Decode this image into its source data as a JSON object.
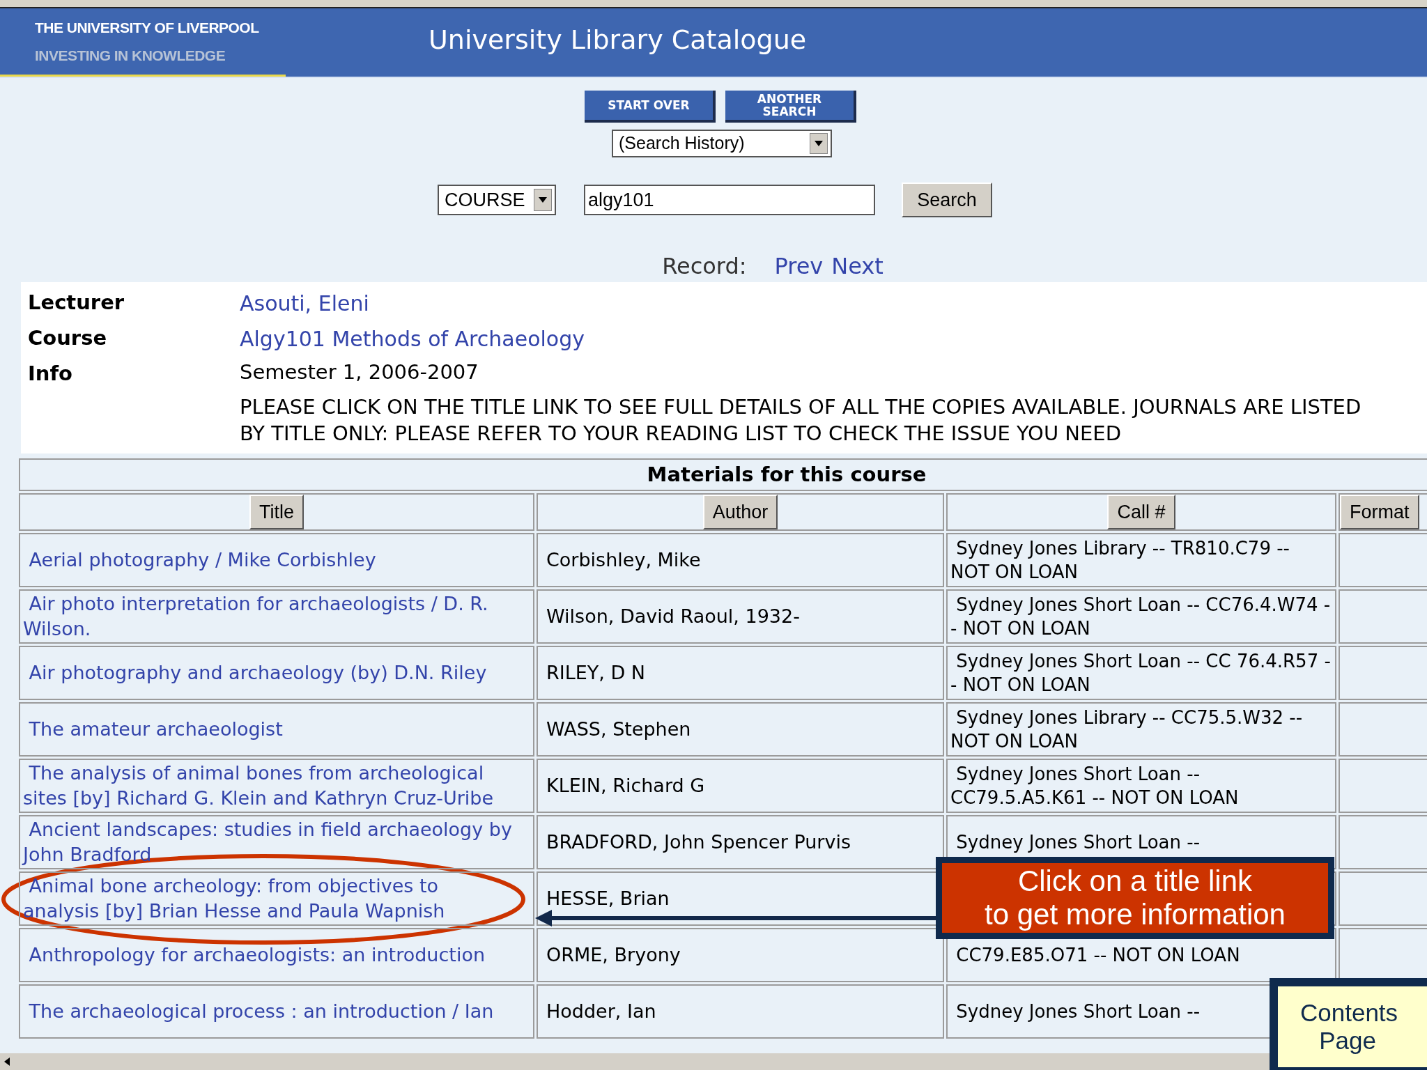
{
  "header": {
    "institution": "THE UNIVERSITY OF LIVERPOOL",
    "tagline": "INVESTING IN KNOWLEDGE",
    "title": "University Library Catalogue"
  },
  "nav_buttons": [
    "START OVER",
    "ANOTHER SEARCH"
  ],
  "history_select": {
    "value": "(Search History)"
  },
  "search": {
    "field": "COURSE",
    "query": "algy101",
    "button": "Search"
  },
  "record_nav": {
    "label": "Record:",
    "links": [
      "Prev",
      "Next"
    ]
  },
  "info": [
    {
      "label": "Lecturer",
      "value": "Asouti, Eleni",
      "kind": "link"
    },
    {
      "label": "Course",
      "value": "Algy101 Methods of Archaeology",
      "kind": "link"
    },
    {
      "label": "Info",
      "value": "Semester 1, 2006-2007",
      "kind": "text"
    },
    {
      "value": "PLEASE CLICK ON THE TITLE LINK TO SEE FULL DETAILS OF ALL THE COPIES AVAILABLE. JOURNALS ARE LISTED BY TITLE ONLY: PLEASE REFER TO YOUR READING LIST TO CHECK THE ISSUE YOU NEED",
      "kind": "text"
    }
  ],
  "table": {
    "caption": "Materials for this course",
    "columns": [
      "Title",
      "Author",
      "Call #",
      "Format"
    ],
    "rows": [
      {
        "title": "Aerial photography / Mike Corbishley",
        "author": "Corbishley, Mike",
        "call": "Sydney Jones Library -- TR810.C79 -- NOT ON LOAN"
      },
      {
        "title": "Air photo interpretation for archaeologists / D. R. Wilson.",
        "author": "Wilson, David Raoul, 1932-",
        "call": "Sydney Jones Short Loan -- CC76.4.W74 -- NOT ON LOAN"
      },
      {
        "title": "Air photography and archaeology (by) D.N. Riley",
        "author": "RILEY, D N",
        "call": "Sydney Jones Short Loan -- CC 76.4.R57 -- NOT ON LOAN"
      },
      {
        "title": "The amateur archaeologist",
        "author": "WASS, Stephen",
        "call": "Sydney Jones Library -- CC75.5.W32 -- NOT ON LOAN"
      },
      {
        "title": "The analysis of animal bones from archeological sites [by] Richard G. Klein and Kathryn Cruz-Uribe",
        "author": "KLEIN, Richard G",
        "call": "Sydney Jones Short Loan -- CC79.5.A5.K61 -- NOT ON LOAN"
      },
      {
        "title": "Ancient landscapes: studies in field archaeology by John Bradford",
        "author": "BRADFORD, John Spencer Purvis",
        "call": "Sydney Jones Short Loan --"
      },
      {
        "title": "Animal bone archeology: from objectives to analysis [by] Brian Hesse and Paula Wapnish",
        "author": "HESSE, Brian"
      },
      {
        "title": "Anthropology for archaeologists: an introduction",
        "author": "ORME, Bryony",
        "call": "CC79.E85.O71 -- NOT ON LOAN"
      },
      {
        "title": "The archaeological process : an introduction / Ian",
        "author": "Hodder, Ian",
        "call": "Sydney Jones Short Loan --"
      }
    ]
  },
  "callout": {
    "lines": [
      "Click on a title link",
      "to get more information"
    ]
  },
  "contents_button": {
    "label": "Contents Page"
  }
}
